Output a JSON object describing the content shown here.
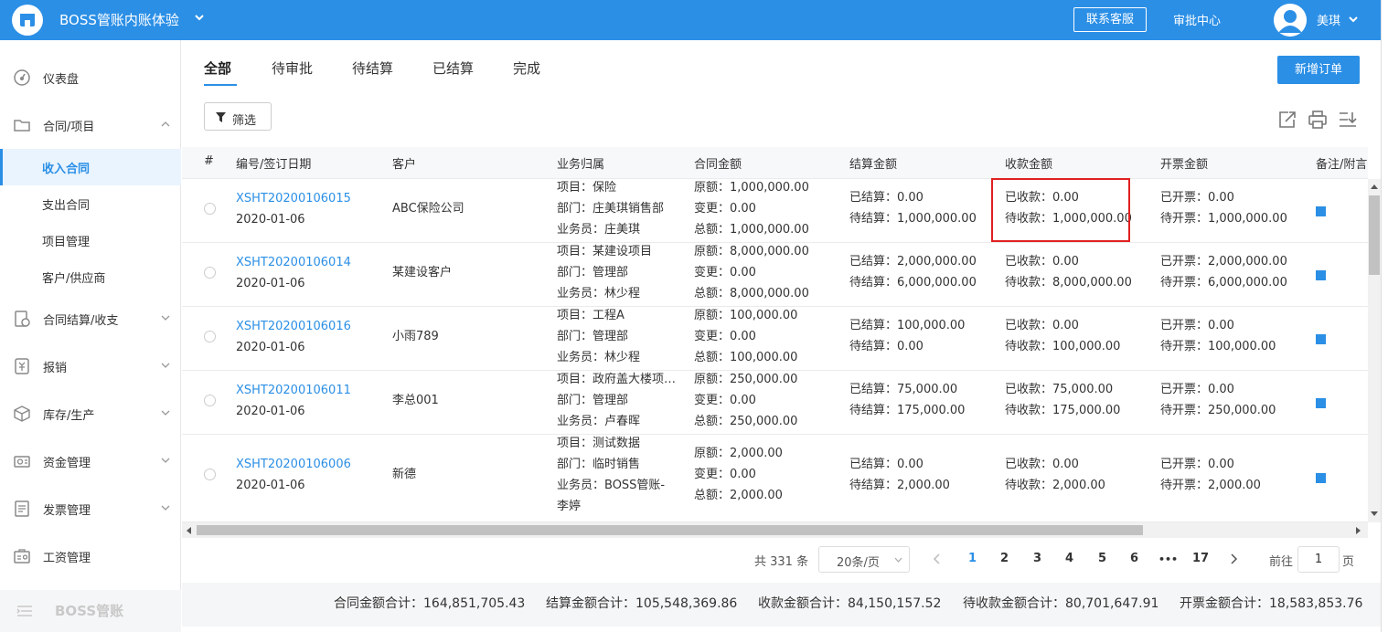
{
  "header": {
    "app_title": "BOSS管账内账体验",
    "contact_label": "联系客服",
    "approval_label": "审批中心",
    "username": "美琪"
  },
  "sidebar": {
    "items": [
      {
        "label": "仪表盘",
        "icon": "dashboard-icon"
      },
      {
        "label": "合同/项目",
        "icon": "folder-icon"
      },
      {
        "label": "合同结算/收支",
        "icon": "settlement-icon"
      },
      {
        "label": "报销",
        "icon": "reimburse-icon"
      },
      {
        "label": "库存/生产",
        "icon": "box-icon"
      },
      {
        "label": "资金管理",
        "icon": "money-icon"
      },
      {
        "label": "发票管理",
        "icon": "invoice-icon"
      },
      {
        "label": "工资管理",
        "icon": "salary-icon"
      }
    ],
    "sub_items": [
      {
        "label": "收入合同",
        "active": true
      },
      {
        "label": "支出合同"
      },
      {
        "label": "项目管理"
      },
      {
        "label": "客户/供应商"
      }
    ],
    "footer_label": "BOSS管账"
  },
  "tabs": [
    {
      "label": "全部",
      "active": true
    },
    {
      "label": "待审批"
    },
    {
      "label": "待结算"
    },
    {
      "label": "已结算"
    },
    {
      "label": "完成"
    }
  ],
  "toolbar": {
    "new_order_label": "新增订单",
    "filter_label": "筛选"
  },
  "table": {
    "columns": [
      "#",
      "编号/签订日期",
      "客户",
      "业务归属",
      "合同金额",
      "结算金额",
      "收款金额",
      "开票金额",
      "备注/附言"
    ],
    "rows": [
      {
        "code": "XSHT20200106015",
        "date": "2020-01-06",
        "customer": "ABC保险公司",
        "biz": [
          "项目：保险",
          "部门：庄美琪销售部",
          "业务员：庄美琪"
        ],
        "amount": [
          "原额：1,000,000.00",
          "变更：0.00",
          "总额：1,000,000.00"
        ],
        "settle": [
          "已结算：0.00",
          "待结算：1,000,000.00"
        ],
        "receipt": [
          "已收款：0.00",
          "待收款：1,000,000.00"
        ],
        "invoice": [
          "已开票：0.00",
          "待开票：1,000,000.00"
        ]
      },
      {
        "code": "XSHT20200106014",
        "date": "2020-01-06",
        "customer": "某建设客户",
        "biz": [
          "项目：某建设项目",
          "部门：管理部",
          "业务员：林少程"
        ],
        "amount": [
          "原额：8,000,000.00",
          "变更：0.00",
          "总额：8,000,000.00"
        ],
        "settle": [
          "已结算：2,000,000.00",
          "待结算：6,000,000.00"
        ],
        "receipt": [
          "已收款：0.00",
          "待收款：8,000,000.00"
        ],
        "invoice": [
          "已开票：2,000,000.00",
          "待开票：6,000,000.00"
        ]
      },
      {
        "code": "XSHT20200106016",
        "date": "2020-01-06",
        "customer": "小雨789",
        "biz": [
          "项目：工程A",
          "部门：管理部",
          "业务员：林少程"
        ],
        "amount": [
          "原额：100,000.00",
          "变更：0.00",
          "总额：100,000.00"
        ],
        "settle": [
          "已结算：100,000.00",
          "待结算：0.00"
        ],
        "receipt": [
          "已收款：0.00",
          "待收款：100,000.00"
        ],
        "invoice": [
          "已开票：0.00",
          "待开票：100,000.00"
        ]
      },
      {
        "code": "XSHT20200106011",
        "date": "2020-01-06",
        "customer": "李总001",
        "biz": [
          "项目：政府盖大楼项…",
          "部门：管理部",
          "业务员：卢春晖"
        ],
        "amount": [
          "原额：250,000.00",
          "变更：0.00",
          "总额：250,000.00"
        ],
        "settle": [
          "已结算：75,000.00",
          "待结算：175,000.00"
        ],
        "receipt": [
          "已收款：75,000.00",
          "待收款：175,000.00"
        ],
        "invoice": [
          "已开票：0.00",
          "待开票：250,000.00"
        ]
      },
      {
        "code": "XSHT20200106006",
        "date": "2020-01-06",
        "customer": "新德",
        "biz": [
          "项目：测试数据",
          "部门：临时销售",
          "业务员：BOSS管账-",
          "李婷"
        ],
        "amount": [
          "原额：2,000.00",
          "变更：0.00",
          "总额：2,000.00"
        ],
        "settle": [
          "已结算：0.00",
          "待结算：2,000.00"
        ],
        "receipt": [
          "已收款：0.00",
          "待收款：2,000.00"
        ],
        "invoice": [
          "已开票：0.00",
          "待开票：2,000.00"
        ]
      }
    ]
  },
  "pagination": {
    "total": "共 331 条",
    "page_size": "20条/页",
    "pages": [
      "1",
      "2",
      "3",
      "4",
      "5",
      "6",
      "17"
    ],
    "ellipsis": "•••",
    "current": "1",
    "goto_label": "前往",
    "goto_value": "1",
    "page_suffix": "页"
  },
  "totals": {
    "contract": "合同金额合计：164,851,705.43",
    "settled": "结算金额合计：105,548,369.86",
    "received": "收款金额合计：84,150,157.52",
    "pending": "待收款金额合计：80,701,647.91",
    "invoiced": "开票金额合计：18,583,853.76"
  },
  "colors": {
    "primary": "#2b8fe6",
    "highlight_border": "#e02020"
  }
}
